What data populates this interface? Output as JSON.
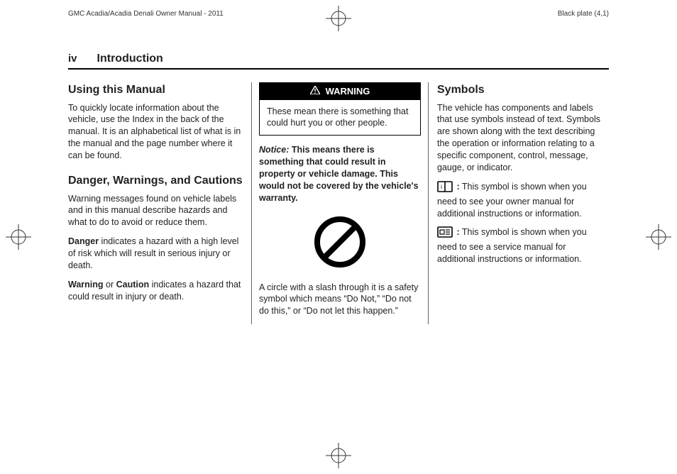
{
  "header": {
    "manual_title": "GMC Acadia/Acadia Denali Owner Manual - 2011",
    "plate": "Black plate (4,1)"
  },
  "page": {
    "number": "iv",
    "section": "Introduction"
  },
  "col1": {
    "h1": "Using this Manual",
    "p1": "To quickly locate information about the vehicle, use the Index in the back of the manual. It is an alphabetical list of what is in the manual and the page number where it can be found.",
    "h2": "Danger, Warnings, and Cautions",
    "p2": "Warning messages found on vehicle labels and in this manual describe hazards and what to do to avoid or reduce them.",
    "danger_label": "Danger",
    "p3_rest": " indicates a hazard with a high level of risk which will result in serious injury or death.",
    "warn_label": "Warning",
    "or_text": " or ",
    "caution_label": "Caution",
    "p4_rest": " indicates a hazard that could result in injury or death."
  },
  "col2": {
    "warning_title": "WARNING",
    "warning_body": "These mean there is something that could hurt you or other people.",
    "notice_label": "Notice:",
    "notice_text": " This means there is something that could result in property or vehicle damage. This would not be covered by the vehicle's warranty.",
    "circle_text": "A circle with a slash through it is a safety symbol which means “Do Not,” “Do not do this,” or “Do not let this happen.”"
  },
  "col3": {
    "h1": "Symbols",
    "p1": "The vehicle has components and labels that use symbols instead of text. Symbols are shown along with the text describing the operation or information relating to a specific component, control, message, gauge, or indicator.",
    "colon1": ":",
    "p2": "  This symbol is shown when you need to see your owner manual for additional instructions or information.",
    "colon2": ":",
    "p3": "  This symbol is shown when you need to see a service manual for additional instructions or information."
  }
}
